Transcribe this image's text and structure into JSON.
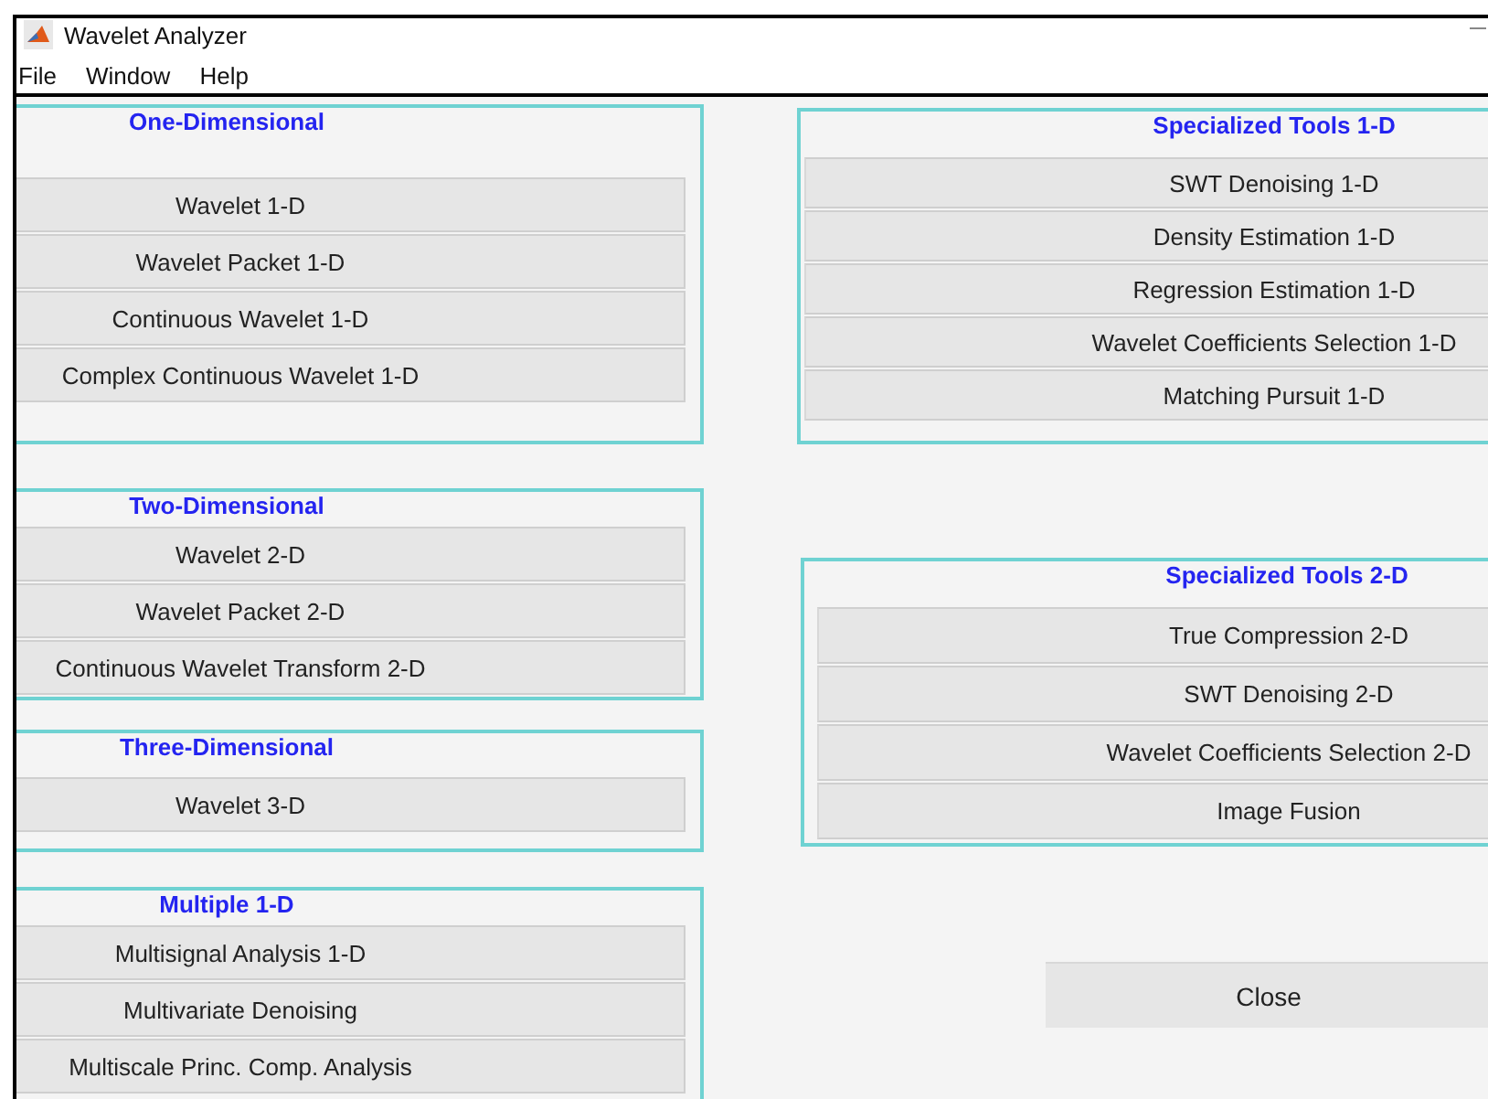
{
  "window": {
    "title": "Wavelet Analyzer"
  },
  "menu": [
    "File",
    "Window",
    "Help"
  ],
  "left_panels": [
    {
      "title": "One-Dimensional",
      "buttons": [
        "Wavelet 1-D",
        "Wavelet Packet 1-D",
        "Continuous Wavelet 1-D",
        "Complex Continuous Wavelet 1-D"
      ]
    },
    {
      "title": "Two-Dimensional",
      "buttons": [
        "Wavelet 2-D",
        "Wavelet Packet 2-D",
        "Continuous Wavelet Transform 2-D"
      ]
    },
    {
      "title": "Three-Dimensional",
      "buttons": [
        "Wavelet 3-D"
      ]
    },
    {
      "title": "Multiple 1-D",
      "buttons": [
        "Multisignal Analysis 1-D",
        "Multivariate Denoising",
        "Multiscale Princ. Comp. Analysis"
      ]
    }
  ],
  "right_panels": [
    {
      "title": "Specialized Tools 1-D",
      "buttons": [
        "SWT Denoising 1-D",
        "Density Estimation 1-D",
        "Regression Estimation 1-D",
        "Wavelet Coefficients Selection 1-D",
        "Matching Pursuit 1-D"
      ]
    },
    {
      "title": "Specialized Tools 2-D",
      "buttons": [
        "True Compression 2-D",
        "SWT Denoising 2-D",
        "Wavelet Coefficients Selection 2-D",
        "Image Fusion"
      ]
    }
  ],
  "close_button": "Close"
}
